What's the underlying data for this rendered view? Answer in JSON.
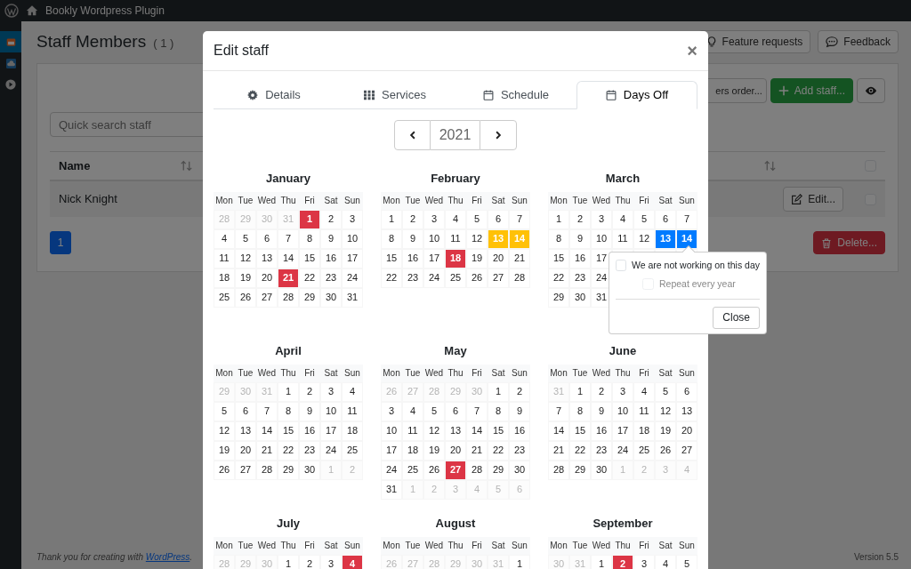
{
  "admin_bar": {
    "site": "Bookly Wordpress Plugin"
  },
  "sidebar": [
    {
      "selected": true
    },
    {
      "selected": false
    },
    {
      "selected": false
    }
  ],
  "page": {
    "title": "Staff Members",
    "count": "( 1 )",
    "header_buttons": [
      "Feature requests",
      "Feedback"
    ],
    "toolbar": [
      {
        "label": "ers order...",
        "kind": "outline"
      },
      {
        "label": "Add staff...",
        "kind": "add"
      }
    ],
    "search": {
      "placeholder": "Quick search staff"
    },
    "table": {
      "columns": [
        "Name"
      ],
      "select_all_checked": false,
      "rows": [
        {
          "name": "Nick Knight",
          "action": "Edit...",
          "checked": false
        }
      ]
    },
    "pagination": [
      {
        "label": "1",
        "selected": true
      }
    ],
    "delete": "Delete..."
  },
  "modal": {
    "title": "Edit staff",
    "close": "×",
    "tabs": [
      {
        "label": "Details",
        "selected": false
      },
      {
        "label": "Services",
        "selected": false
      },
      {
        "label": "Schedule",
        "selected": false
      },
      {
        "label": "Days Off",
        "selected": true
      }
    ],
    "year": "2021",
    "months": [
      {
        "name": "January",
        "weekdays": [
          "Mon",
          "Tue",
          "Wed",
          "Thu",
          "Fri",
          "Sat",
          "Sun"
        ],
        "prev_days": [
          "28",
          "29",
          "30",
          "31"
        ],
        "weeks": [
          [
            {
              "day": "1",
              "color": "#dc3545"
            },
            "2",
            "3"
          ],
          [
            "4",
            "5",
            "6",
            "7",
            "8",
            "9",
            "10"
          ],
          [
            "11",
            "12",
            "13",
            "14",
            "15",
            "16",
            "17"
          ],
          [
            "18",
            "19",
            "20",
            {
              "day": "21",
              "color": "#dc3545"
            },
            "22",
            "23",
            "24"
          ],
          [
            "25",
            "26",
            "27",
            "28",
            "29",
            "30",
            "31"
          ]
        ]
      },
      {
        "name": "February",
        "weekdays": [
          "Mon",
          "Tue",
          "Wed",
          "Thu",
          "Fri",
          "Sat",
          "Sun"
        ],
        "weeks": [
          [
            "1",
            "2",
            "3",
            "4",
            "5",
            "6",
            "7"
          ],
          [
            "8",
            "9",
            "10",
            "11",
            "12",
            {
              "day": "13",
              "color": "#ffc107"
            },
            {
              "day": "14",
              "color": "#ffc107"
            }
          ],
          [
            "15",
            "16",
            "17",
            {
              "day": "18",
              "color": "#dc3545"
            },
            "19",
            "20",
            "21"
          ],
          [
            "22",
            "23",
            "24",
            "25",
            "26",
            "27",
            "28"
          ]
        ]
      },
      {
        "name": "March",
        "weekdays": [
          "Mon",
          "Tue",
          "Wed",
          "Thu",
          "Fri",
          "Sat",
          "Sun"
        ],
        "weeks": [
          [
            "1",
            "2",
            "3",
            "4",
            "5",
            "6",
            "7"
          ],
          [
            "8",
            "9",
            "10",
            "11",
            "12",
            {
              "day": "13",
              "color": "#007bff"
            },
            {
              "day": "14",
              "color": "#007bff"
            }
          ],
          [
            "15",
            "16",
            "17"
          ],
          [
            "22",
            "23",
            "24"
          ],
          [
            "29",
            "30",
            "31"
          ]
        ]
      },
      {
        "name": "April",
        "weekdays": [
          "Mon",
          "Tue",
          "Wed",
          "Thu",
          "Fri",
          "Sat",
          "Sun"
        ],
        "prev_days": [
          "29",
          "30",
          "31"
        ],
        "weeks": [
          [
            "1",
            "2",
            "3",
            "4"
          ],
          [
            "5",
            "6",
            "7",
            "8",
            "9",
            "10",
            "11"
          ],
          [
            "12",
            "13",
            "14",
            "15",
            "16",
            "17",
            "18"
          ],
          [
            "19",
            "20",
            "21",
            "22",
            "23",
            "24",
            "25"
          ],
          [
            "26",
            "27",
            "28",
            "29",
            "30"
          ]
        ],
        "next_days": [
          "1",
          "2"
        ]
      },
      {
        "name": "May",
        "weekdays": [
          "Mon",
          "Tue",
          "Wed",
          "Thu",
          "Fri",
          "Sat",
          "Sun"
        ],
        "prev_days": [
          "26",
          "27",
          "28",
          "29",
          "30"
        ],
        "weeks": [
          [
            "1",
            "2"
          ],
          [
            "3",
            "4",
            "5",
            "6",
            "7",
            "8",
            "9"
          ],
          [
            "10",
            "11",
            "12",
            "13",
            "14",
            "15",
            "16"
          ],
          [
            "17",
            "18",
            "19",
            "20",
            "21",
            "22",
            "23"
          ],
          [
            "24",
            "25",
            "26",
            {
              "day": "27",
              "color": "#dc3545"
            },
            "28",
            "29",
            "30"
          ],
          [
            "31"
          ]
        ],
        "next_days": [
          "1",
          "2",
          "3",
          "4",
          "5",
          "6"
        ]
      },
      {
        "name": "June",
        "weekdays": [
          "Mon",
          "Tue",
          "Wed",
          "Thu",
          "Fri",
          "Sat",
          "Sun"
        ],
        "prev_days": [
          "31"
        ],
        "weeks": [
          [
            "1",
            "2",
            "3",
            "4",
            "5",
            "6"
          ],
          [
            "7",
            "8",
            "9",
            "10",
            "11",
            "12",
            "13"
          ],
          [
            "14",
            "15",
            "16",
            "17",
            "18",
            "19",
            "20"
          ],
          [
            "21",
            "22",
            "23",
            "24",
            "25",
            "26",
            "27"
          ],
          [
            "28",
            "29",
            "30"
          ]
        ],
        "next_days": [
          "1",
          "2",
          "3",
          "4"
        ]
      },
      {
        "name": "July",
        "weekdays": [
          "Mon",
          "Tue",
          "Wed",
          "Thu",
          "Fri",
          "Sat",
          "Sun"
        ],
        "prev_days": [
          "28",
          "29",
          "30"
        ],
        "weeks": [
          [
            "1",
            "2",
            "3",
            {
              "day": "4",
              "color": "#dc3545"
            }
          ]
        ]
      },
      {
        "name": "August",
        "weekdays": [
          "Mon",
          "Tue",
          "Wed",
          "Thu",
          "Fri",
          "Sat",
          "Sun"
        ],
        "prev_days": [
          "26",
          "27",
          "28",
          "29",
          "30",
          "31"
        ],
        "weeks": [
          [
            "1"
          ]
        ]
      },
      {
        "name": "September",
        "weekdays": [
          "Mon",
          "Tue",
          "Wed",
          "Thu",
          "Fri",
          "Sat",
          "Sun"
        ],
        "prev_days": [
          "30",
          "31"
        ],
        "weeks": [
          [
            "1",
            {
              "day": "2",
              "color": "#dc3545"
            },
            "3",
            "4",
            "5"
          ]
        ]
      }
    ],
    "popover": {
      "options": [
        {
          "label": "We are not working on this day",
          "checked": false,
          "disabled": false
        },
        {
          "label": "Repeat every year",
          "checked": false,
          "disabled": true
        }
      ],
      "button": "Close"
    }
  },
  "footer": {
    "text": "Thank you for creating with ",
    "link": "WordPress",
    "end": ".",
    "version": "Version 5.5"
  }
}
